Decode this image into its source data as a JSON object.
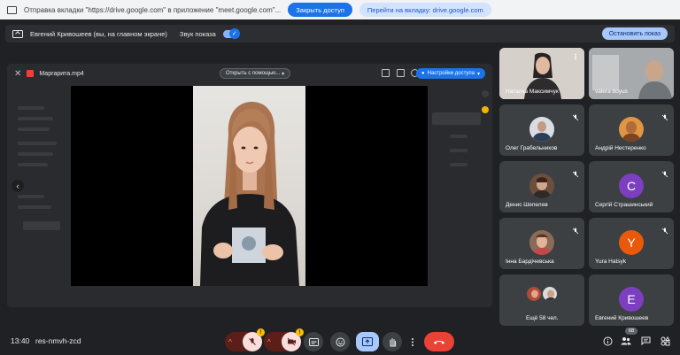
{
  "share_bar": {
    "message": "Отправка вкладки \"https://drive.google.com\" в приложение \"meet.google.com\"...",
    "stop_label": "Закрыть доступ",
    "switch_label": "Перейти на вкладку: drive.google.com"
  },
  "present_bar": {
    "presenter_text": "Евгений Кривошеев (вы, на главном экране)",
    "sound_label": "Звук показа",
    "stop_label": "Остановить показ"
  },
  "drive": {
    "file_name": "Маргарита.mp4",
    "open_with_label": "Открыть с помощью...",
    "access_label": "Настройки доступа"
  },
  "participants": [
    {
      "name": "Наталка Максимчук",
      "type": "video"
    },
    {
      "name": "valera boyus",
      "type": "video"
    },
    {
      "name": "Олег Грабельников",
      "type": "photo",
      "color": "#8a9bb0"
    },
    {
      "name": "Андрій Нестеренко",
      "type": "photo",
      "color": "#d4893a"
    },
    {
      "name": "Денис Шепелев",
      "type": "photo",
      "color": "#7a5a48"
    },
    {
      "name": "Сергій Страшинський",
      "type": "letter",
      "letter": "С",
      "color": "#7b3fbf"
    },
    {
      "name": "Інна Бардічевська",
      "type": "photo",
      "color": "#6e4a3a"
    },
    {
      "name": "Yura Hatsyk",
      "type": "letter",
      "letter": "Y",
      "color": "#e8590c"
    },
    {
      "name": "Ещё 58 чел.",
      "type": "group"
    },
    {
      "name": "Евгений Кривошеев",
      "type": "letter",
      "letter": "E",
      "color": "#7b3fbf"
    }
  ],
  "bottom": {
    "time": "13:40",
    "meeting_code": "res-nmvh-zcd",
    "mic_badge": "!",
    "cam_badge": "!",
    "people_count": "68"
  },
  "colors": {
    "accent": "#1a73e8",
    "end_call": "#ea4335",
    "warning": "#fbbc04"
  }
}
